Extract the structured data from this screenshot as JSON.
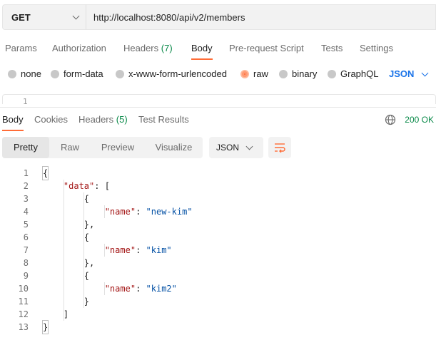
{
  "request": {
    "method": "GET",
    "url": "http://localhost:8080/api/v2/members"
  },
  "request_tabs": [
    {
      "label": "Params"
    },
    {
      "label": "Authorization"
    },
    {
      "label": "Headers",
      "count": "(7)"
    },
    {
      "label": "Body",
      "active": true
    },
    {
      "label": "Pre-request Script"
    },
    {
      "label": "Tests"
    },
    {
      "label": "Settings"
    }
  ],
  "body_types": [
    {
      "label": "none"
    },
    {
      "label": "form-data"
    },
    {
      "label": "x-www-form-urlencoded"
    },
    {
      "label": "raw",
      "selected": true
    },
    {
      "label": "binary"
    },
    {
      "label": "GraphQL"
    }
  ],
  "body_language": "JSON",
  "request_editor": {
    "first_line": "1"
  },
  "response_tabs": [
    {
      "label": "Body",
      "active": true
    },
    {
      "label": "Cookies"
    },
    {
      "label": "Headers",
      "count": "(5)"
    },
    {
      "label": "Test Results"
    }
  ],
  "response_status": "200 OK",
  "view_modes": [
    {
      "label": "Pretty",
      "active": true
    },
    {
      "label": "Raw"
    },
    {
      "label": "Preview"
    },
    {
      "label": "Visualize"
    }
  ],
  "response_format": "JSON",
  "code_lines": [
    {
      "n": "1",
      "text": "{"
    },
    {
      "n": "2",
      "text": "    \"data\": ["
    },
    {
      "n": "3",
      "text": "        {"
    },
    {
      "n": "4",
      "text": "            \"name\": \"new-kim\""
    },
    {
      "n": "5",
      "text": "        },"
    },
    {
      "n": "6",
      "text": "        {"
    },
    {
      "n": "7",
      "text": "            \"name\": \"kim\""
    },
    {
      "n": "8",
      "text": "        },"
    },
    {
      "n": "9",
      "text": "        {"
    },
    {
      "n": "10",
      "text": "            \"name\": \"kim2\""
    },
    {
      "n": "11",
      "text": "        }"
    },
    {
      "n": "12",
      "text": "    ]"
    },
    {
      "n": "13",
      "text": "}"
    }
  ],
  "colors": {
    "accent": "#ff6c37",
    "status_ok": "#0b8a4a",
    "link_blue": "#1a73e8",
    "json_key": "#a31515",
    "json_string": "#0451a5"
  },
  "icons": [
    "chevron-down-icon",
    "globe-icon",
    "wrap-lines-icon"
  ]
}
